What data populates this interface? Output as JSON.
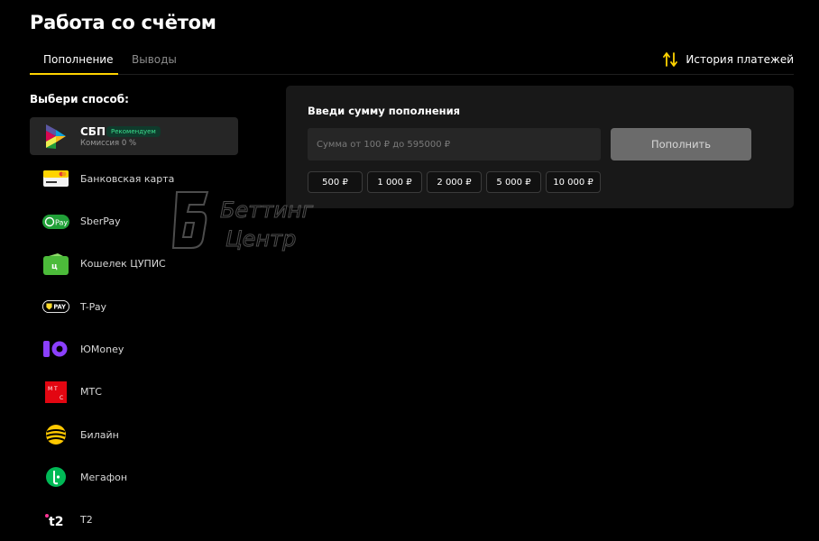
{
  "page": {
    "title": "Работа со счётом"
  },
  "tabs": [
    {
      "label": "Пополнение",
      "active": true
    },
    {
      "label": "Выводы",
      "active": false
    }
  ],
  "history": {
    "label": "История платежей",
    "icon": "swap-vertical-icon"
  },
  "methods_heading": "Выбери способ:",
  "methods": [
    {
      "label": "СБП",
      "badge": "Рекомендуем",
      "sub": "Комиссия 0 %",
      "icon": "sbp-icon",
      "selected": true
    },
    {
      "label": "Банковская карта",
      "icon": "bank-card-icon"
    },
    {
      "label": "SberPay",
      "icon": "sberpay-icon"
    },
    {
      "label": "Кошелек ЦУПИС",
      "icon": "cupis-wallet-icon"
    },
    {
      "label": "T-Pay",
      "icon": "tpay-icon"
    },
    {
      "label": "ЮMoney",
      "icon": "yoomoney-icon"
    },
    {
      "label": "МТС",
      "icon": "mts-icon"
    },
    {
      "label": "Билайн",
      "icon": "beeline-icon"
    },
    {
      "label": "Мегафон",
      "icon": "megafon-icon"
    },
    {
      "label": "Т2",
      "icon": "t2-icon"
    }
  ],
  "deposit": {
    "title": "Введи сумму пополнения",
    "placeholder": "Сумма от 100 ₽ до 595000 ₽",
    "button": "Пополнить",
    "presets": [
      "500 ₽",
      "1 000 ₽",
      "2 000 ₽",
      "5 000 ₽",
      "10 000 ₽"
    ]
  },
  "watermark": {
    "line1": "Беттинг",
    "line2": "Центр"
  },
  "colors": {
    "accent": "#ffd400",
    "background": "#000000",
    "panel": "#181818",
    "badge_text": "#3ce08f"
  }
}
